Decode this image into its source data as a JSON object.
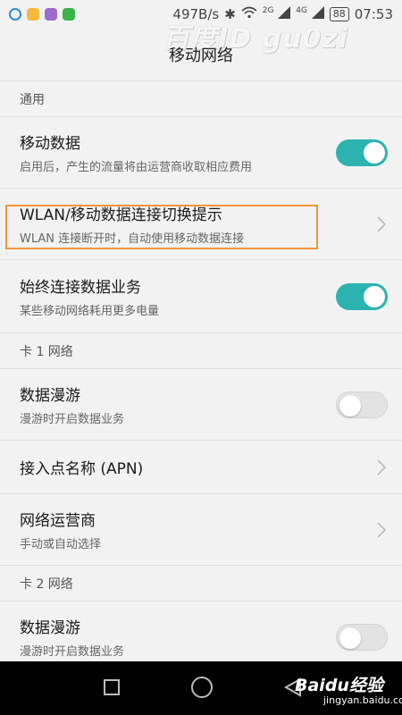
{
  "status_bar": {
    "speed": "497B/s",
    "net1": "2G",
    "net2": "4G",
    "battery": "88",
    "time": "07:53"
  },
  "watermark": "百度ID gu0zi",
  "header": {
    "title": "移动网络"
  },
  "sections": [
    {
      "header": "通用",
      "rows": [
        {
          "title": "移动数据",
          "subtitle": "启用后，产生的流量将由运营商收取相应费用",
          "control": "toggle",
          "state": "on"
        },
        {
          "title": "WLAN/移动数据连接切换提示",
          "subtitle": "WLAN 连接断开时，自动使用移动数据连接",
          "control": "chevron"
        },
        {
          "title": "始终连接数据业务",
          "subtitle": "某些移动网络耗用更多电量",
          "control": "toggle",
          "state": "on"
        }
      ]
    },
    {
      "header": "卡 1 网络",
      "rows": [
        {
          "title": "数据漫游",
          "subtitle": "漫游时开启数据业务",
          "control": "toggle",
          "state": "off"
        },
        {
          "title": "接入点名称 (APN)",
          "control": "chevron"
        },
        {
          "title": "网络运营商",
          "subtitle": "手动或自动选择",
          "control": "chevron"
        }
      ]
    },
    {
      "header": "卡 2 网络",
      "rows": [
        {
          "title": "数据漫游",
          "subtitle": "漫游时开启数据业务",
          "control": "toggle",
          "state": "off"
        }
      ]
    }
  ],
  "footer": {
    "brand": "Baidu经验",
    "site": "jingyan.baidu.com"
  },
  "colors": {
    "accent": "#2bb3b0",
    "highlight": "#f0963c",
    "background": "#f2f2f2"
  }
}
